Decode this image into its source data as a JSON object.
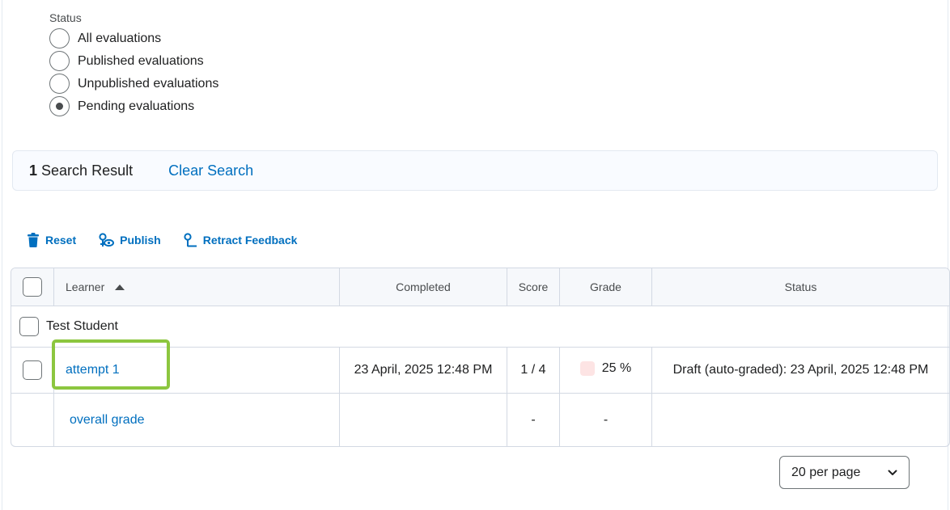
{
  "status_filter": {
    "label": "Status",
    "options": [
      {
        "label": "All evaluations",
        "selected": false
      },
      {
        "label": "Published evaluations",
        "selected": false
      },
      {
        "label": "Unpublished evaluations",
        "selected": false
      },
      {
        "label": "Pending evaluations",
        "selected": true
      }
    ]
  },
  "search": {
    "count": "1",
    "count_label": "Search Result",
    "clear_label": "Clear Search"
  },
  "toolbar": {
    "reset_label": "Reset",
    "publish_label": "Publish",
    "retract_label": "Retract Feedback"
  },
  "table": {
    "headers": {
      "learner": "Learner",
      "completed": "Completed",
      "score": "Score",
      "grade": "Grade",
      "status": "Status"
    },
    "student": {
      "name": "Test Student"
    },
    "attempt": {
      "label": "attempt 1",
      "completed": "23 April, 2025 12:48 PM",
      "score": "1 / 4",
      "grade": "25 %",
      "status": "Draft (auto-graded): 23 April, 2025 12:48 PM"
    },
    "overall": {
      "label": "overall grade",
      "score": "-",
      "grade": "-"
    }
  },
  "pagination": {
    "per_page": "20 per page"
  },
  "colors": {
    "link": "#006fbf",
    "highlight": "#8cc63f",
    "grade_swatch": "#fde4e4"
  }
}
